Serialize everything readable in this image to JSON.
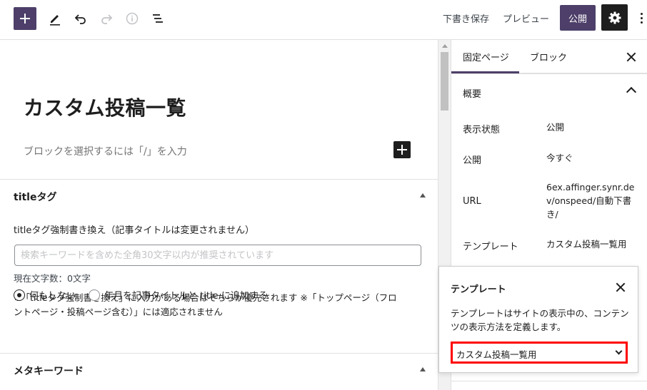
{
  "topbar": {
    "save_draft": "下書き保存",
    "preview": "プレビュー",
    "publish": "公開"
  },
  "editor": {
    "title": "カスタム投稿一覧",
    "block_hint": "ブロックを選択するには「/」を入力"
  },
  "title_tag_box": {
    "heading": "titleタグ",
    "field_label": "titleタグ強制書き換え（記事タイトルは変更されません）",
    "input_value": "",
    "input_placeholder": "検索キーワードを含めた全角30文字以内が推奨されています",
    "char_count": "現在文字数：0文字",
    "note_line1": "※「titleタグ強制書き換え」に入力がある場合はそちらが優先されます ※「トップページ（フロ",
    "note_line2": "ントページ・投稿ページ含む）」には適応されません",
    "radio_options": [
      {
        "label": "何もしない",
        "checked": true
      },
      {
        "label": "年月を記事タイトルと title に追加する",
        "checked": false
      }
    ]
  },
  "meta_keyword_box": {
    "heading": "メタキーワード"
  },
  "sidebar": {
    "tabs": [
      {
        "label": "固定ページ",
        "active": true
      },
      {
        "label": "ブロック",
        "active": false
      }
    ],
    "panel_title": "概要",
    "rows": [
      {
        "label": "表示状態",
        "value": "公開"
      },
      {
        "label": "公開",
        "value": "今すぐ"
      },
      {
        "label": "URL",
        "value": "6ex.affinger.synr.dev/onspeed/自動下書き/"
      },
      {
        "label": "テンプレート",
        "value": "カスタム投稿一覧用"
      }
    ]
  },
  "template_popover": {
    "title": "テンプレート",
    "description": "テンプレートはサイトの表示中の、コンテンツの表示方法を定義します。",
    "selected": "カスタム投稿一覧用",
    "highlight_color": "#ff0000"
  },
  "colors": {
    "accent": "#4d3f69",
    "dark": "#1e1e1e"
  }
}
